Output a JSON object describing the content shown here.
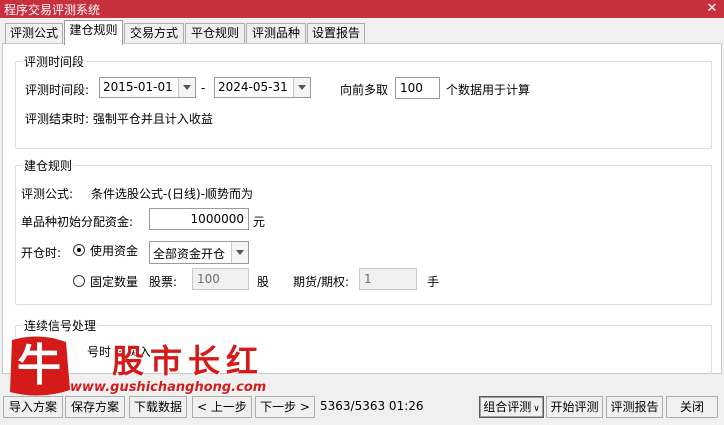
{
  "window": {
    "title": "程序交易评测系统",
    "close_glyph": "✕"
  },
  "tabs": [
    {
      "label": "评测公式",
      "active": false
    },
    {
      "label": "建仓规则",
      "active": true
    },
    {
      "label": "交易方式",
      "active": false
    },
    {
      "label": "平仓规则",
      "active": false
    },
    {
      "label": "评测品种",
      "active": false
    },
    {
      "label": "设置报告",
      "active": false
    }
  ],
  "period": {
    "legend": "评测时间段",
    "range_label": "评测时间段:",
    "start_date": "2015-01-01",
    "dash": "-",
    "end_date": "2024-05-31",
    "lookback_prefix": "向前多取",
    "lookback_value": "100",
    "lookback_suffix": "个数据用于计算",
    "end_label": "评测结束时: 强制平仓并且计入收益"
  },
  "build": {
    "legend": "建仓规则",
    "formula_label": "评测公式:",
    "formula_value": "条件选股公式-(日线)-顺势而为",
    "capital_label": "单品种初始分配资金:",
    "capital_value": "1000000",
    "capital_unit": "元",
    "open_label": "开仓时:",
    "use_capital_label": "使用资金",
    "use_capital_checked": true,
    "capital_mode_value": "全部资金开仓",
    "fixed_qty_label": "固定数量",
    "fixed_qty_checked": false,
    "stock_label": "股票:",
    "stock_value": "100",
    "stock_unit": "股",
    "futures_label": "期货/期权:",
    "futures_value": "1",
    "futures_unit": "手"
  },
  "signal": {
    "legend": "连续信号处理",
    "partial_text": "号时 再买入"
  },
  "bottom": {
    "import_label": "导入方案",
    "save_label": "保存方案",
    "download_label": "下载数据",
    "prev_label": "< 上一步",
    "next_label": "下一步 >",
    "status": "5363/5363 01:26",
    "combo_label": "组合评测",
    "start_label": "开始评测",
    "report_label": "评测报告",
    "close_label": "关闭"
  },
  "watermark": {
    "title": "股市长红",
    "url": "www.gushichanghong.com",
    "niu_char": "牛"
  },
  "colors": {
    "titlebar": "#c8303e",
    "watermark": "#d51a1a"
  }
}
